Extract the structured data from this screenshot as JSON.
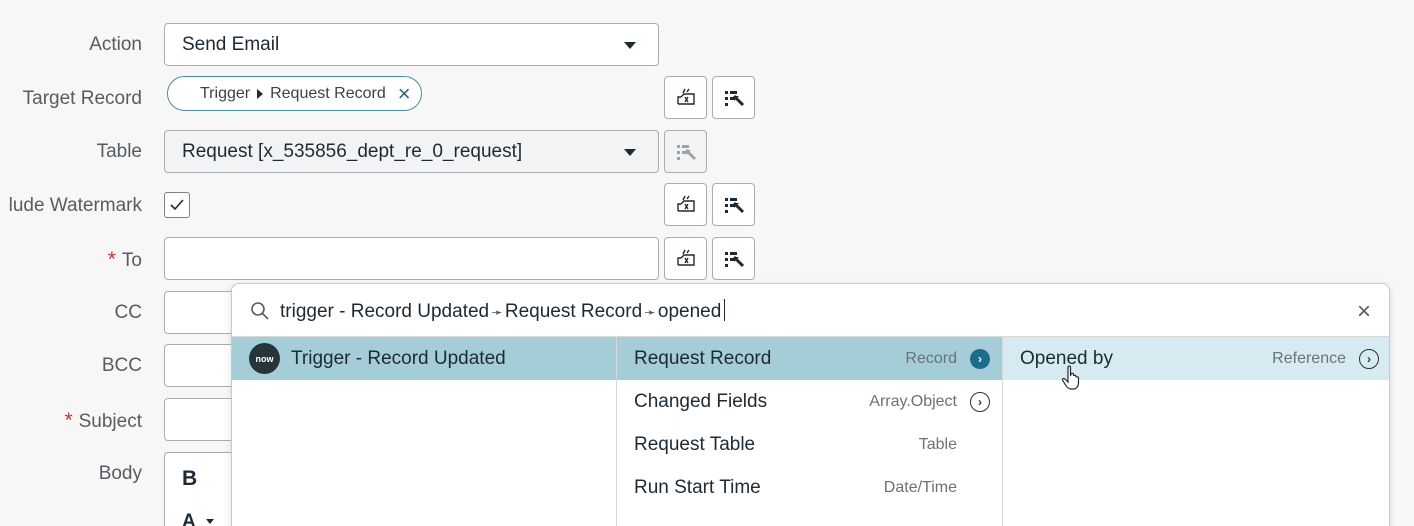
{
  "form": {
    "labels": {
      "action": "Action",
      "target_record": "Target Record",
      "table": "Table",
      "include_watermark": "lude Watermark",
      "to": "To",
      "cc": "CC",
      "bcc": "BCC",
      "subject": "Subject",
      "body": "Body"
    },
    "required_marker": "*",
    "action_value": "Send Email",
    "target_pill": {
      "part1": "Trigger",
      "part2": "Request Record"
    },
    "table_value": "Request [x_535856_dept_re_0_request]",
    "watermark_checked": true,
    "body_toolbar": {
      "bold": "B",
      "font_color": "A"
    }
  },
  "picker": {
    "search_parts": [
      "trigger - Record Updated",
      "Request Record",
      "opened"
    ],
    "search_separator": "➛",
    "col1": [
      {
        "logo": "now",
        "label": "Trigger - Record Updated",
        "selected": true
      }
    ],
    "col2": [
      {
        "label": "Request Record",
        "type": "Record",
        "arrow": "solid",
        "selected": true
      },
      {
        "label": "Changed Fields",
        "type": "Array.Object",
        "arrow": "outline"
      },
      {
        "label": "Request Table",
        "type": "Table"
      },
      {
        "label": "Run Start Time",
        "type": "Date/Time"
      }
    ],
    "col3": [
      {
        "label": "Opened by",
        "type": "Reference",
        "arrow": "outline",
        "hovered": true
      }
    ]
  },
  "colors": {
    "selected_row": "#a4cdd8",
    "hover_row": "#d6ebf1",
    "accent": "#1c6d8c",
    "required": "#c8342b"
  },
  "icons": {
    "data_pill_picker": "data-pill-picker-icon",
    "dot_walk": "dot-walk-icon",
    "search": "search-icon",
    "clear": "close-icon",
    "pointer": "hand-pointer-icon"
  }
}
